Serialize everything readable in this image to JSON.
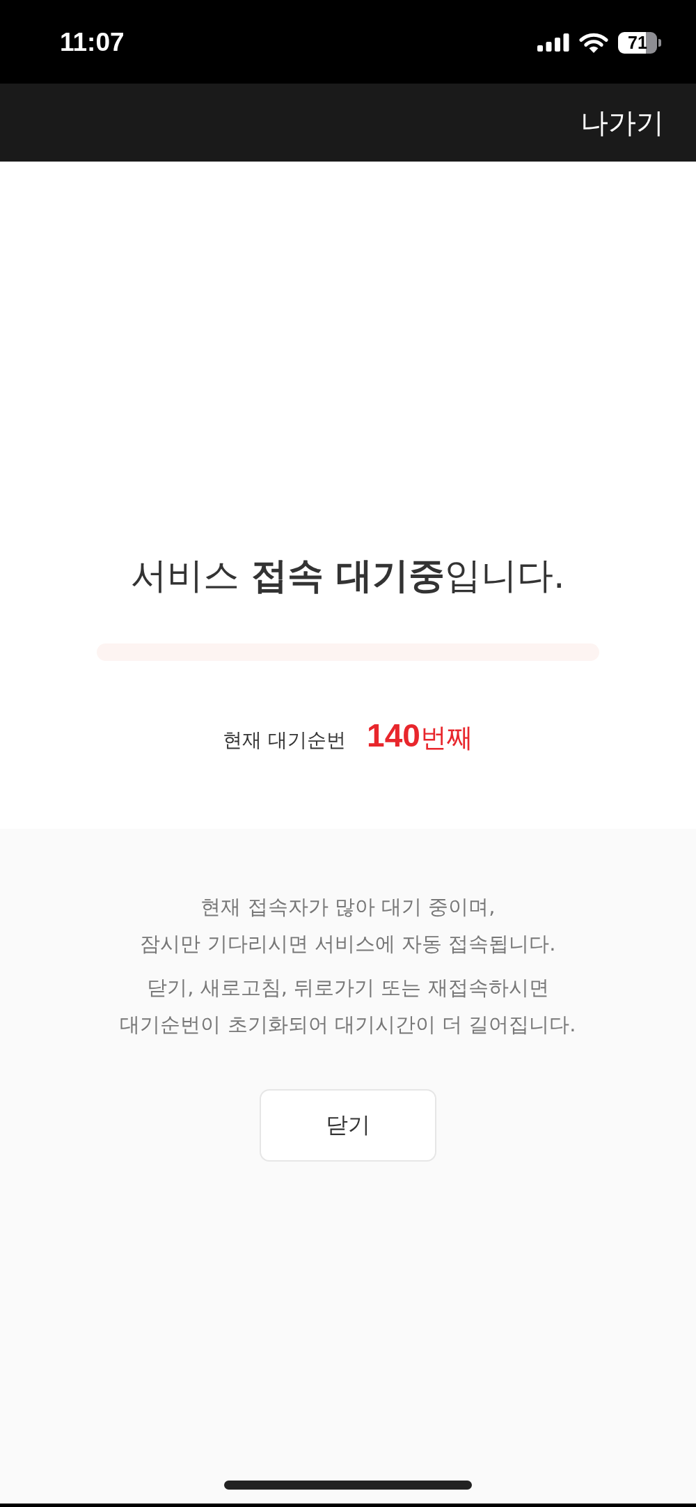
{
  "status_bar": {
    "time": "11:07",
    "battery": "71"
  },
  "header": {
    "exit_button": "나가기"
  },
  "queue": {
    "title": "서비스 **접속 대기중**입니다.",
    "progress": {
      "level": 0
    },
    "position_label": "현재 대기순번",
    "position_number": "140",
    "position_suffix": "번째"
  },
  "notice": {
    "paragraphs": [
      [
        "현재 접속자가 많아 대기 중이며,",
        "잠시만 기다리시면 서비스에 자동 접속됩니다."
      ],
      [
        "닫기, 새로고침, 뒤로가기 또는 재접속하시면",
        "대기순번이 초기화되어 대기시간이 더 길어집니다."
      ]
    ]
  },
  "close_button": "닫기"
}
